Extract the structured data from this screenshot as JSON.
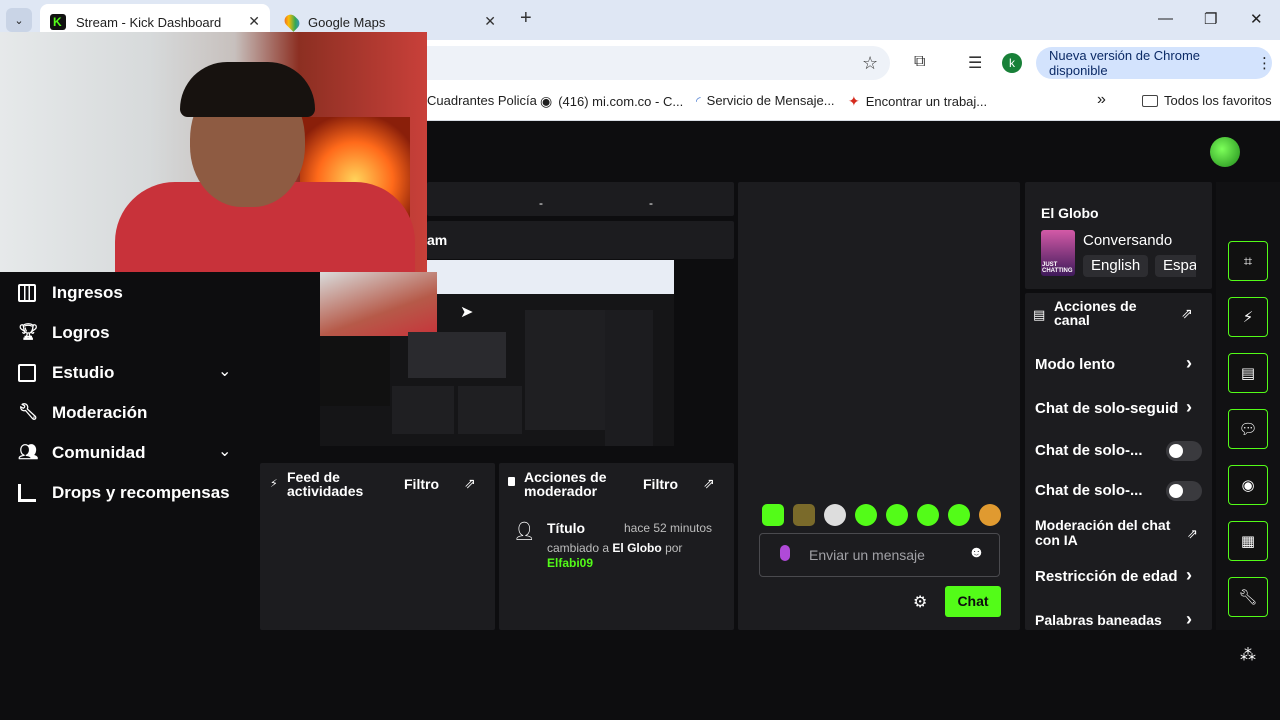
{
  "browser": {
    "tabs": [
      {
        "title": "Stream - Kick Dashboard",
        "active": true
      },
      {
        "title": "Google Maps",
        "active": false
      }
    ],
    "new_tab": "+",
    "bookmarks": [
      {
        "label": "Cuadrantes Policía"
      },
      {
        "label": "(416) mi.com.co - C..."
      },
      {
        "label": "Servicio de Mensaje..."
      },
      {
        "label": "Encontrar un trabaj..."
      }
    ],
    "bookmarks_more": "»",
    "all_bookmarks": "Todos los favoritos",
    "update_button": "Nueva versión de Chrome disponible",
    "profile_initial": "k",
    "accent": "#53fc18"
  },
  "sidebar": {
    "items": [
      {
        "label": "Ingresos",
        "icon": "chart-icon"
      },
      {
        "label": "Logros",
        "icon": "trophy-icon"
      },
      {
        "label": "Estudio",
        "icon": "studio-icon",
        "expandable": true
      },
      {
        "label": "Moderación",
        "icon": "wrench-icon"
      },
      {
        "label": "Comunidad",
        "icon": "community-icon",
        "expandable": true
      },
      {
        "label": "Drops y recompensas",
        "icon": "drops-icon"
      }
    ]
  },
  "center": {
    "header_fragment": "am",
    "dash_marks": [
      "-",
      "-"
    ]
  },
  "activity_feed": {
    "title": "Feed de actividades",
    "filter": "Filtro"
  },
  "mod_actions": {
    "title": "Acciones de moderador",
    "filter": "Filtro",
    "entry": {
      "field": "Título",
      "time": "hace 52 minutos",
      "prefix": "cambiado a",
      "value": "El Globo",
      "by": "por",
      "user": "Elfabi09"
    }
  },
  "chat": {
    "placeholder": "Enviar un mensaje",
    "send_label": "Chat"
  },
  "stream_info": {
    "title": "El Globo",
    "category": "Conversando",
    "tags": [
      "English",
      "Espa"
    ],
    "thumb_text": "JUST CHATTING"
  },
  "channel_actions": {
    "title": "Acciones de canal",
    "items": [
      {
        "label": "Modo lento",
        "control": "arrow"
      },
      {
        "label": "Chat de solo-seguido",
        "control": "arrow"
      },
      {
        "label": "Chat de solo-...",
        "control": "toggle"
      },
      {
        "label": "Chat de solo-...",
        "control": "toggle"
      },
      {
        "label": "Moderación del chat con IA",
        "control": "external"
      },
      {
        "label": "Restricción de edad",
        "control": "arrow"
      },
      {
        "label": "Palabras baneadas",
        "control": "arrow"
      }
    ]
  },
  "rail": {
    "buttons": [
      "camera-frame-icon",
      "bolt-icon",
      "note-icon",
      "chat-bubble-icon",
      "broadcast-icon",
      "layout-icon",
      "wrench-icon"
    ]
  }
}
